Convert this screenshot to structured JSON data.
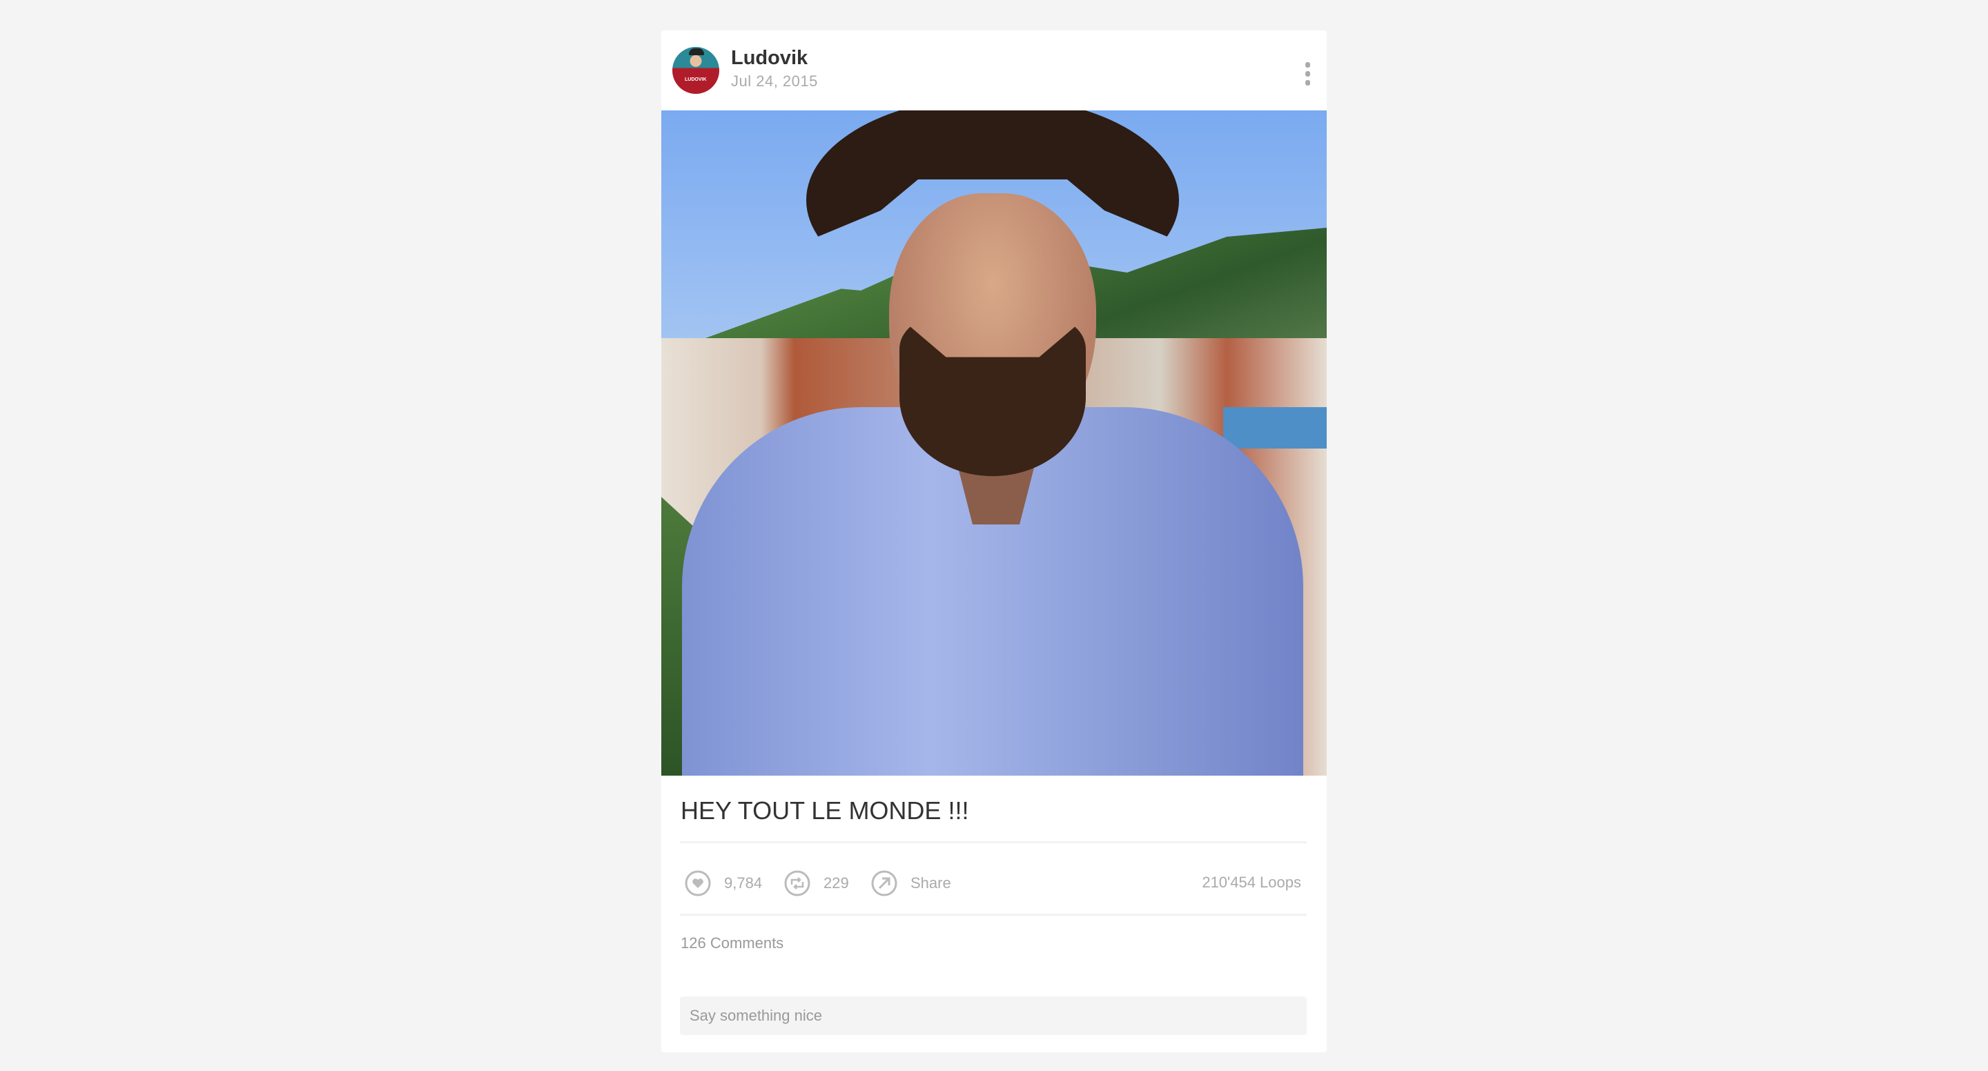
{
  "post": {
    "username": "Ludovik",
    "date": "Jul 24, 2015",
    "avatar_text": "LUDOVIK",
    "caption": "HEY TOUT LE MONDE !!!",
    "likes": "9,784",
    "revines": "229",
    "share_label": "Share",
    "loops": "210'454 Loops",
    "comments": "126 Comments",
    "comment_placeholder": "Say something nice"
  },
  "icons": {
    "more": "more-vertical-icon",
    "like": "heart-icon",
    "revine": "revine-icon",
    "share": "share-arrow-icon"
  },
  "colors": {
    "background": "#f4f4f4",
    "card": "#ffffff",
    "muted": "#aaaaaa",
    "text": "#333333"
  }
}
